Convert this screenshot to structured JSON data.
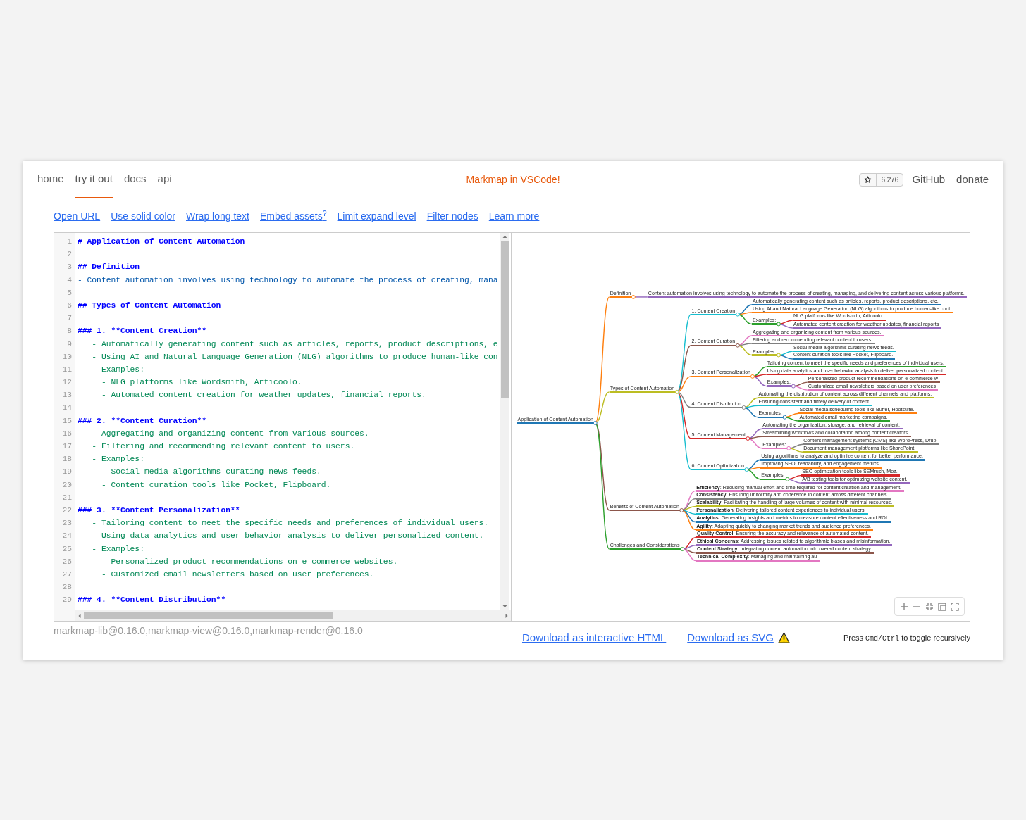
{
  "nav": {
    "items": [
      {
        "label": "home",
        "selected": false
      },
      {
        "label": "try it out",
        "selected": true
      },
      {
        "label": "docs",
        "selected": false
      },
      {
        "label": "api",
        "selected": false
      }
    ],
    "banner": "Markmap in VSCode!",
    "stars": "6,276",
    "links": [
      "GitHub",
      "donate"
    ]
  },
  "options": [
    "Open URL",
    "Use solid color",
    "Wrap long text",
    "Embed assets$^{?}$",
    "Limit expand level",
    "Filter nodes",
    "Learn more"
  ],
  "editor": {
    "lines": [
      {
        "n": "1",
        "kind": "h",
        "text": "# Application of Content Automation"
      },
      {
        "n": "2",
        "kind": "blank"
      },
      {
        "n": "3",
        "kind": "h",
        "text": "## Definition"
      },
      {
        "n": "4",
        "kind": "list1",
        "text": "- Content automation involves using technology to automate the process of creating, mana"
      },
      {
        "n": "5",
        "kind": "blank"
      },
      {
        "n": "6",
        "kind": "h",
        "text": "## Types of Content Automation"
      },
      {
        "n": "7",
        "kind": "blank"
      },
      {
        "n": "8",
        "kind": "h",
        "text": "### 1. **Content Creation**"
      },
      {
        "n": "9",
        "kind": "list2",
        "text": "   - Automatically generating content such as articles, reports, product descriptions, e"
      },
      {
        "n": "10",
        "kind": "list2",
        "text": "   - Using AI and Natural Language Generation (NLG) algorithms to produce human-like con"
      },
      {
        "n": "11",
        "kind": "list2",
        "text": "   - Examples:"
      },
      {
        "n": "12",
        "kind": "list2",
        "text": "     - NLG platforms like Wordsmith, Articoolo."
      },
      {
        "n": "13",
        "kind": "list2",
        "text": "     - Automated content creation for weather updates, financial reports."
      },
      {
        "n": "14",
        "kind": "blank"
      },
      {
        "n": "15",
        "kind": "h",
        "text": "### 2. **Content Curation**"
      },
      {
        "n": "16",
        "kind": "list2",
        "text": "   - Aggregating and organizing content from various sources."
      },
      {
        "n": "17",
        "kind": "list2",
        "text": "   - Filtering and recommending relevant content to users."
      },
      {
        "n": "18",
        "kind": "list2",
        "text": "   - Examples:"
      },
      {
        "n": "19",
        "kind": "list2",
        "text": "     - Social media algorithms curating news feeds."
      },
      {
        "n": "20",
        "kind": "list2",
        "text": "     - Content curation tools like Pocket, Flipboard."
      },
      {
        "n": "21",
        "kind": "blank"
      },
      {
        "n": "22",
        "kind": "h",
        "text": "### 3. **Content Personalization**"
      },
      {
        "n": "23",
        "kind": "list2",
        "text": "   - Tailoring content to meet the specific needs and preferences of individual users."
      },
      {
        "n": "24",
        "kind": "list2",
        "text": "   - Using data analytics and user behavior analysis to deliver personalized content."
      },
      {
        "n": "25",
        "kind": "list2",
        "text": "   - Examples:"
      },
      {
        "n": "26",
        "kind": "list2",
        "text": "     - Personalized product recommendations on e-commerce websites."
      },
      {
        "n": "27",
        "kind": "list2",
        "text": "     - Customized email newsletters based on user preferences."
      },
      {
        "n": "28",
        "kind": "blank"
      },
      {
        "n": "29",
        "kind": "h",
        "text": "### 4. **Content Distribution**"
      }
    ]
  },
  "mindmap": {
    "root": {
      "text": "Application of Content Automation",
      "color": "#1f77b4",
      "children": [
        {
          "text": "Definition",
          "color": "#ff7f0e",
          "children": [
            {
              "text": "Content automation involves using technology to automate the process of creating, managing, and delivering content across various platforms.",
              "color": "#9467bd"
            }
          ]
        },
        {
          "text": "Types of Content Automation",
          "color": "#bcbd22",
          "children": [
            {
              "text": "1. Content Creation",
              "color": "#17becf",
              "children": [
                {
                  "text": "Automatically generating content such as articles, reports, product descriptions, etc.",
                  "color": "#1f77b4"
                },
                {
                  "text": "Using AI and Natural Language Generation (NLG) algorithms to produce human-like cont",
                  "color": "#ff7f0e"
                },
                {
                  "text": "Examples:",
                  "color": "#2ca02c",
                  "children": [
                    {
                      "text": "NLG platforms like Wordsmith, Articoolo.",
                      "color": "#d62728"
                    },
                    {
                      "text": "Automated content creation for weather updates, financial reports",
                      "color": "#9467bd"
                    }
                  ]
                }
              ]
            },
            {
              "text": "2. Content Curation",
              "color": "#8c564b",
              "children": [
                {
                  "text": "Aggregating and organizing content from various sources.",
                  "color": "#e377c2"
                },
                {
                  "text": "Filtering and recommending relevant content to users.",
                  "color": "#7f7f7f"
                },
                {
                  "text": "Examples:",
                  "color": "#bcbd22",
                  "children": [
                    {
                      "text": "Social media algorithms curating news feeds.",
                      "color": "#17becf"
                    },
                    {
                      "text": "Content curation tools like Pocket, Flipboard.",
                      "color": "#1f77b4"
                    }
                  ]
                }
              ]
            },
            {
              "text": "3. Content Personalization",
              "color": "#ff7f0e",
              "children": [
                {
                  "text": "Tailoring content to meet the specific needs and preferences of individual users.",
                  "color": "#2ca02c"
                },
                {
                  "text": "Using data analytics and user behavior analysis to deliver personalized content.",
                  "color": "#d62728"
                },
                {
                  "text": "Examples:",
                  "color": "#9467bd",
                  "children": [
                    {
                      "text": "Personalized product recommendations on e-commerce w",
                      "color": "#8c564b"
                    },
                    {
                      "text": "Customized email newsletters based on user preferences",
                      "color": "#e377c2"
                    }
                  ]
                }
              ]
            },
            {
              "text": "4. Content Distribution",
              "color": "#7f7f7f",
              "children": [
                {
                  "text": "Automating the distribution of content across different channels and platforms.",
                  "color": "#bcbd22"
                },
                {
                  "text": "Ensuring consistent and timely delivery of content.",
                  "color": "#17becf"
                },
                {
                  "text": "Examples:",
                  "color": "#1f77b4",
                  "children": [
                    {
                      "text": "Social media scheduling tools like Buffer, Hootsuite.",
                      "color": "#ff7f0e"
                    },
                    {
                      "text": "Automated email marketing campaigns.",
                      "color": "#2ca02c"
                    }
                  ]
                }
              ]
            },
            {
              "text": "5. Content Management",
              "color": "#d62728",
              "children": [
                {
                  "text": "Automating the organization, storage, and retrieval of content.",
                  "color": "#9467bd"
                },
                {
                  "text": "Streamlining workflows and collaboration among content creators.",
                  "color": "#8c564b"
                },
                {
                  "text": "Examples:",
                  "color": "#e377c2",
                  "children": [
                    {
                      "text": "Content management systems (CMS) like WordPress, Drup",
                      "color": "#7f7f7f"
                    },
                    {
                      "text": "Document management platforms like SharePoint.",
                      "color": "#bcbd22"
                    }
                  ]
                }
              ]
            },
            {
              "text": "6. Content Optimization",
              "color": "#17becf",
              "children": [
                {
                  "text": "Using algorithms to analyze and optimize content for better performance.",
                  "color": "#1f77b4"
                },
                {
                  "text": "Improving SEO, readability, and engagement metrics.",
                  "color": "#ff7f0e"
                },
                {
                  "text": "Examples:",
                  "color": "#2ca02c",
                  "children": [
                    {
                      "text": "SEO optimization tools like SEMrush, Moz.",
                      "color": "#d62728"
                    },
                    {
                      "text": "A/B testing tools for optimizing website content.",
                      "color": "#9467bd"
                    }
                  ]
                }
              ]
            }
          ]
        },
        {
          "text": "Benefits of Content Automation",
          "color": "#8c564b",
          "children": [
            {
              "text": "**Efficiency**: Reducing manual effort and time required for content creation and management.",
              "color": "#e377c2"
            },
            {
              "text": "**Consistency**: Ensuring uniformity and coherence in content across different channels.",
              "color": "#7f7f7f"
            },
            {
              "text": "**Scalability**: Facilitating the handling of large volumes of content with minimal resources.",
              "color": "#bcbd22"
            },
            {
              "text": "**Personalization**: Delivering tailored content experiences to individual users.",
              "color": "#17becf"
            },
            {
              "text": "**Analytics**: Generating insights and metrics to measure content effectiveness and ROI.",
              "color": "#1f77b4"
            },
            {
              "text": "**Agility**: Adapting quickly to changing market trends and audience preferences.",
              "color": "#ff7f0e"
            }
          ]
        },
        {
          "text": "Challenges and Considerations",
          "color": "#2ca02c",
          "children": [
            {
              "text": "**Quality Control**: Ensuring the accuracy and relevance of automated content.",
              "color": "#d62728"
            },
            {
              "text": "**Ethical Concerns**: Addressing issues related to algorithmic biases and misinformation.",
              "color": "#9467bd"
            },
            {
              "text": "**Content Strategy**: Integrating content automation into overall content strategy.",
              "color": "#8c564b"
            },
            {
              "text": "**Technical Complexity**: Managing and maintaining au",
              "color": "#e377c2"
            }
          ]
        }
      ]
    }
  },
  "footer": {
    "versions": "markmap-lib@0.16.0,markmap-view@0.16.0,markmap-render@0.16.0",
    "downloads": [
      "Download as interactive HTML",
      "Download as SVG"
    ],
    "hint": {
      "before": "Press",
      "keys": "Cmd/Ctrl",
      "after": "to toggle recursively"
    }
  }
}
